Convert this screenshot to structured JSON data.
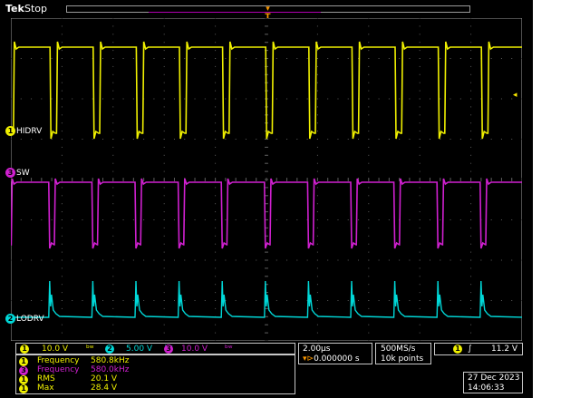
{
  "header": {
    "brand": "Tek",
    "run_state": "Stop",
    "trigger_marker": "T"
  },
  "colors": {
    "ch1": "#f0f000",
    "ch2": "#00d8d8",
    "ch3": "#d020d0",
    "grid": "#5a5a5a",
    "trigger": "#ff9a00"
  },
  "channels": {
    "ch1": {
      "number": "1",
      "label": "HIDRV",
      "scale": "10.0 V",
      "coupling_icon": "bw-limit-icon"
    },
    "ch2": {
      "number": "2",
      "label": "LODRV",
      "scale": "5.00 V",
      "coupling_icon": "bw-limit-icon"
    },
    "ch3": {
      "number": "3",
      "label": "SW",
      "scale": "10.0 V",
      "coupling_icon": "bw-limit-icon"
    }
  },
  "timebase": {
    "time_div": "2.00µs",
    "delay": "0.000000 s",
    "sample_rate": "500MS/s",
    "record_length": "10k points"
  },
  "trigger": {
    "source": "1",
    "slope_icon": "rising-edge-icon",
    "level": "11.2 V"
  },
  "measurements": [
    {
      "channel": "1",
      "name": "Frequency",
      "value": "580.8kHz"
    },
    {
      "channel": "3",
      "name": "Frequency",
      "value": "580.0kHz"
    },
    {
      "channel": "1",
      "name": "RMS",
      "value": "20.1 V"
    },
    {
      "channel": "1",
      "name": "Max",
      "value": "28.4 V"
    }
  ],
  "datetime": {
    "date": "27 Dec  2023",
    "time": "14:06:33"
  }
}
